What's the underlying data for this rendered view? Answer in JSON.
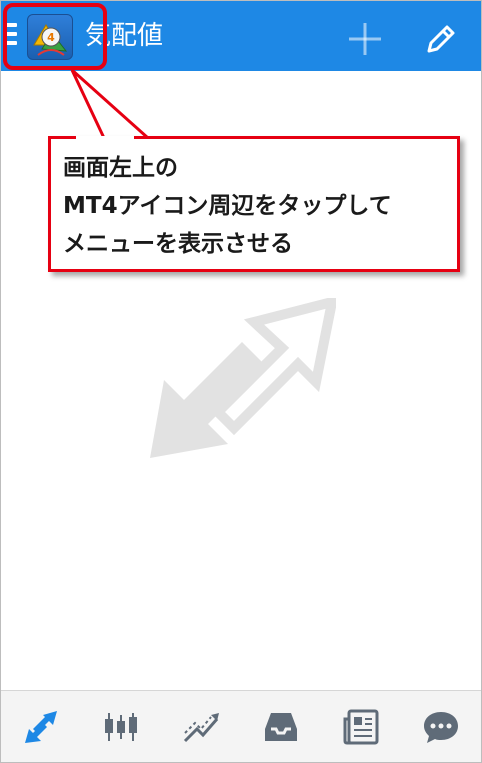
{
  "header": {
    "title": "気配値",
    "menu_icon": "hamburger-icon",
    "app_icon": "mt4-logo",
    "add_icon": "plus-icon",
    "edit_icon": "pencil-icon",
    "bar_color": "#1e88e5"
  },
  "callout": {
    "line1": "画面左上の",
    "line2": "MT4アイコン周辺をタップして",
    "line3": "メニューを表示させる",
    "border_color": "#e60012"
  },
  "app_icon_badge": "4",
  "empty_state_icon": "quotes-arrows-icon",
  "bottom_nav": {
    "items": [
      {
        "icon": "quotes-icon",
        "active": true
      },
      {
        "icon": "candlestick-chart-icon",
        "active": false
      },
      {
        "icon": "trade-icon",
        "active": false
      },
      {
        "icon": "history-inbox-icon",
        "active": false
      },
      {
        "icon": "news-icon",
        "active": false
      },
      {
        "icon": "chat-icon",
        "active": false
      }
    ],
    "active_color": "#1e88e5",
    "inactive_color": "#5f6b78"
  }
}
